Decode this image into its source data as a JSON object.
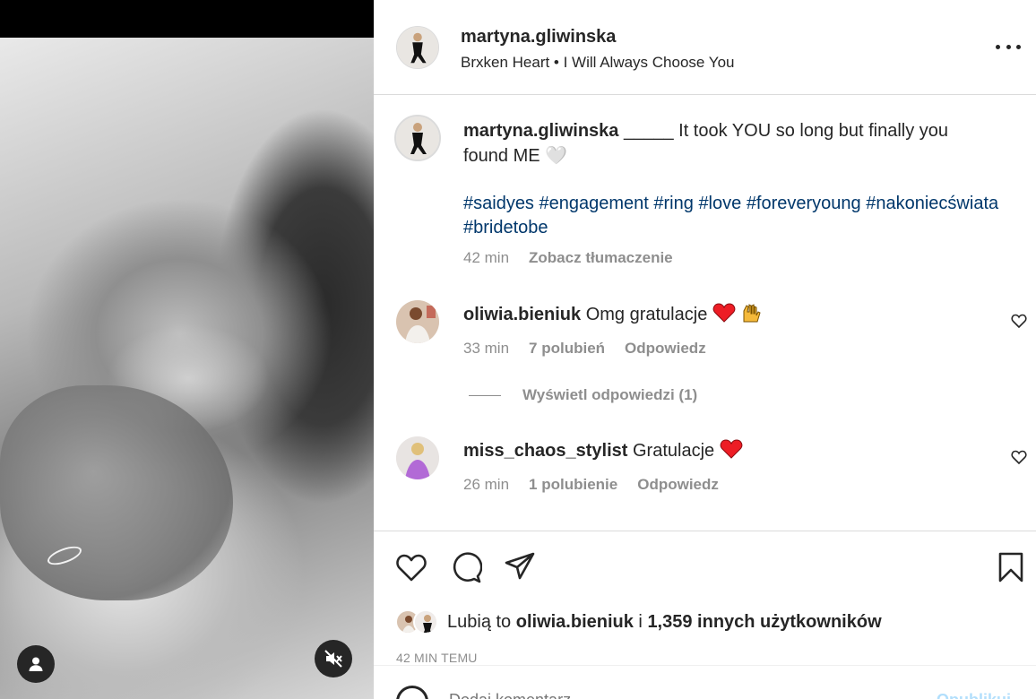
{
  "post": {
    "username": "martyna.gliwinska",
    "subtitle": "Brxken Heart • I Will Always Choose You",
    "caption": {
      "username": "martyna.gliwinska",
      "text": " _____ It took YOU so long but finally you found ME 🤍",
      "hashtags": [
        "#saidyes",
        "#engagement",
        "#ring",
        "#love",
        "#foreveryoung",
        "#nakoniecświata",
        "#bridetobe"
      ],
      "time": "42 min",
      "translate": "Zobacz tłumaczenie"
    }
  },
  "comments": [
    {
      "username": "oliwia.bieniuk",
      "text": " Omg gratulacje ",
      "emojis": [
        "heart",
        "raising-hands"
      ],
      "time": "33 min",
      "likes": "7 polubień",
      "reply": "Odpowiedz"
    },
    {
      "username": "miss_chaos_stylist",
      "text": " Gratulacje ",
      "emojis": [
        "heart"
      ],
      "time": "26 min",
      "likes": "1 polubienie",
      "reply": "Odpowiedz"
    }
  ],
  "view_replies": "Wyświetl odpowiedzi (1)",
  "likes": {
    "prefix": "Lubią to ",
    "user": "oliwia.bieniuk",
    "middle": " i ",
    "count": "1,359 innych użytkowników"
  },
  "timestamp": "42 MIN TEMU",
  "add_comment": {
    "placeholder": "Dodaj komentarz...",
    "post_label": "Opublikuj"
  },
  "colors": {
    "text": "#262626",
    "muted": "#8e8e8e",
    "hashtag": "#00376b",
    "heart_red": "#ed1d25",
    "divider": "#dbdbdb"
  }
}
